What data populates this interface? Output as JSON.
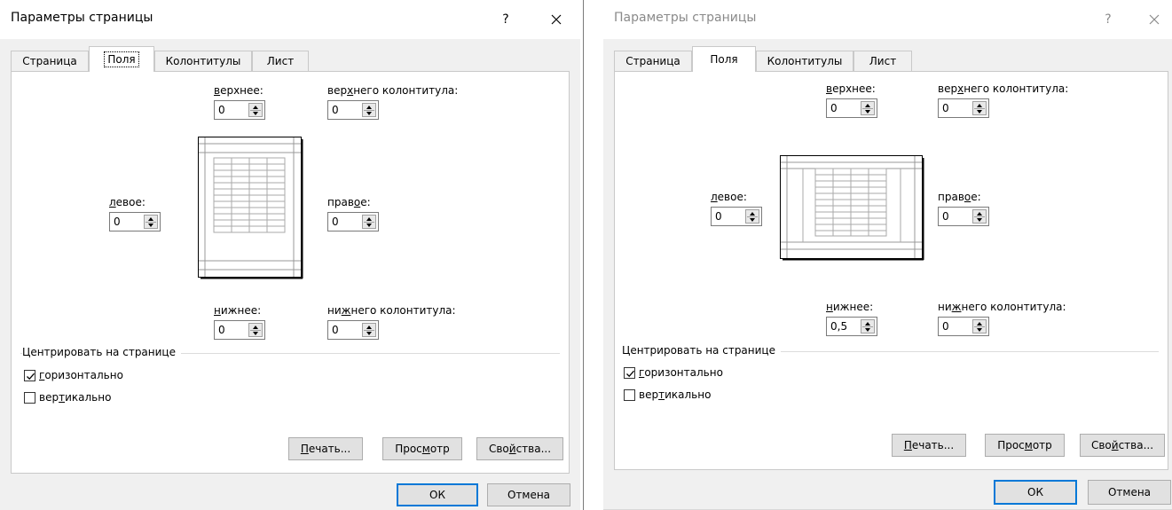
{
  "left": {
    "title": "Параметры страницы",
    "help_glyph": "?",
    "close_icon": "close-icon",
    "tabs": [
      {
        "label": "Страница"
      },
      {
        "label": "Поля"
      },
      {
        "label": "Колонтитулы"
      },
      {
        "label": "Лист"
      }
    ],
    "active_tab": "Поля",
    "fields": {
      "top": {
        "pre": "",
        "key": "в",
        "post": "ерхнее:",
        "value": "0"
      },
      "header": {
        "pre": "вер",
        "key": "х",
        "post": "него колонтитула:",
        "value": "0"
      },
      "left": {
        "pre": "",
        "key": "л",
        "post": "евое:",
        "value": "0"
      },
      "right": {
        "pre": "прав",
        "key": "о",
        "post": "е:",
        "value": "0"
      },
      "bottom": {
        "pre": "",
        "key": "н",
        "post": "ижнее:",
        "value": "0"
      },
      "footer": {
        "pre": "ни",
        "key": "ж",
        "post": "него колонтитула:",
        "value": "0"
      }
    },
    "center_section": "Центрировать на странице",
    "horizontal": {
      "pre": "",
      "key": "г",
      "post": "оризонтально",
      "checked": true
    },
    "vertical": {
      "pre": "вер",
      "key": "т",
      "post": "икально",
      "checked": false
    },
    "buttons": {
      "print": {
        "pre": "",
        "key": "П",
        "post": "ечать..."
      },
      "preview": {
        "pre": "Прос",
        "key": "м",
        "post": "отр"
      },
      "properties": {
        "pre": "Сво",
        "key": "й",
        "post": "ства..."
      },
      "ok": "ОК",
      "cancel": "Отмена"
    }
  },
  "right": {
    "title": "Параметры страницы",
    "help_glyph": "?",
    "close_icon": "close-icon",
    "tabs": [
      {
        "label": "Страница"
      },
      {
        "label": "Поля"
      },
      {
        "label": "Колонтитулы"
      },
      {
        "label": "Лист"
      }
    ],
    "active_tab": "Поля",
    "fields": {
      "top": {
        "pre": "",
        "key": "в",
        "post": "ерхнее:",
        "value": "0"
      },
      "header": {
        "pre": "вер",
        "key": "х",
        "post": "него колонтитула:",
        "value": "0"
      },
      "left": {
        "pre": "",
        "key": "л",
        "post": "евое:",
        "value": "0"
      },
      "right": {
        "pre": "прав",
        "key": "о",
        "post": "е:",
        "value": "0"
      },
      "bottom": {
        "pre": "",
        "key": "н",
        "post": "ижнее:",
        "value": "0,5"
      },
      "footer": {
        "pre": "ни",
        "key": "ж",
        "post": "него колонтитула:",
        "value": "0"
      }
    },
    "center_section": "Центрировать на странице",
    "horizontal": {
      "pre": "",
      "key": "г",
      "post": "оризонтально",
      "checked": true
    },
    "vertical": {
      "pre": "вер",
      "key": "т",
      "post": "икально",
      "checked": false
    },
    "buttons": {
      "print": {
        "pre": "",
        "key": "П",
        "post": "ечать..."
      },
      "preview": {
        "pre": "Прос",
        "key": "м",
        "post": "отр"
      },
      "properties": {
        "pre": "Сво",
        "key": "й",
        "post": "ства..."
      },
      "ok": "ОК",
      "cancel": "Отмена"
    }
  },
  "colors": {
    "dialog_bg": "#f0f0f0",
    "pane_bg": "#ffffff",
    "default_button_border": "#0078d7",
    "inactive_title": "#8a8a8a"
  }
}
